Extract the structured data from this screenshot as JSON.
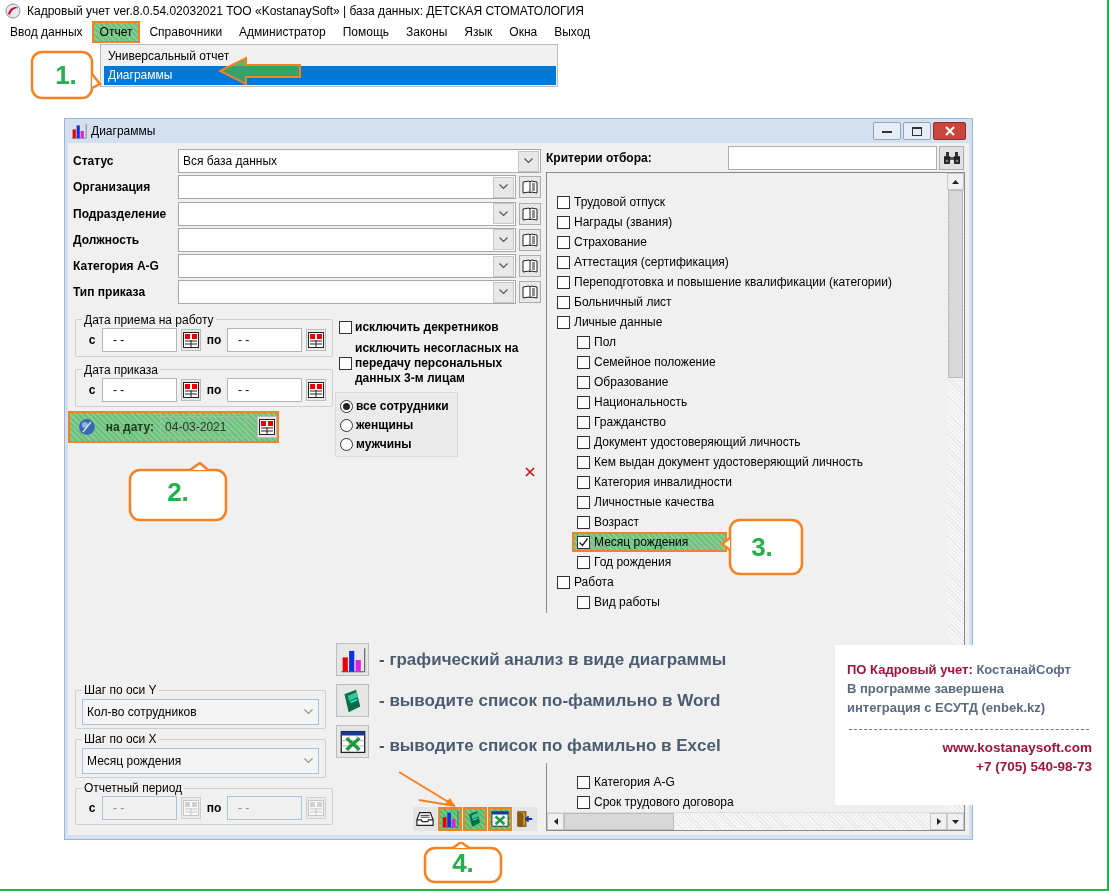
{
  "window": {
    "title": "Кадровый учет ver.8.0.54.02032021 ТОО «KostanaySoft» | база данных: ДЕТСКАЯ СТОМАТОЛОГИЯ"
  },
  "menu": [
    {
      "label": "Ввод данных",
      "selected": false
    },
    {
      "label": "Отчет",
      "selected": true
    },
    {
      "label": "Справочники",
      "selected": false
    },
    {
      "label": "Администратор",
      "selected": false
    },
    {
      "label": "Помощь",
      "selected": false
    },
    {
      "label": "Законы",
      "selected": false
    },
    {
      "label": "Язык",
      "selected": false
    },
    {
      "label": "Окна",
      "selected": false
    },
    {
      "label": "Выход",
      "selected": false
    }
  ],
  "dropdown": [
    {
      "label": "Универсальный отчет",
      "selected": false
    },
    {
      "label": "Диаграммы",
      "selected": true
    }
  ],
  "dialog": {
    "title": "Диаграммы",
    "fields": [
      {
        "label": "Статус",
        "value": "Вся база данных",
        "lookup": false
      },
      {
        "label": "Организация",
        "lookup": true
      },
      {
        "label": "Подразделение",
        "lookup": true
      },
      {
        "label": "Должность",
        "lookup": true
      },
      {
        "label": "Категория A-G",
        "lookup": true
      },
      {
        "label": "Тип приказа",
        "lookup": true
      }
    ],
    "hire_date": {
      "legend": "Дата приема на работу",
      "from_label": "с",
      "from": "- -",
      "to_label": "по",
      "to": "- -",
      "disabled": false
    },
    "order_date": {
      "legend": "Дата приказа",
      "from_label": "с",
      "from": "- -",
      "to_label": "по",
      "to": "- -",
      "disabled": false
    },
    "as_of": {
      "label": "на дату:",
      "value": "04-03-2021",
      "highlighted": true
    },
    "options": [
      {
        "label": "исключить декретников",
        "checked": false
      },
      {
        "label": "исключить несогласных на передачу персональных данных 3-м лицам",
        "checked": false
      }
    ],
    "gender": [
      {
        "label": "все сотрудники",
        "selected": true
      },
      {
        "label": "женщины",
        "selected": false
      },
      {
        "label": "мужчины",
        "selected": false
      }
    ],
    "y_axis": {
      "legend": "Шаг по оси Y",
      "value": "Кол-во сотрудников"
    },
    "x_axis": {
      "legend": "Шаг по оси X",
      "value": "Месяц рождения"
    },
    "period": {
      "legend": "Отчетный период",
      "from_label": "с",
      "from": "- -",
      "to_label": "по",
      "to": "- -",
      "disabled": true
    },
    "toolbar": [
      {
        "kind": "tray",
        "highlighted": false
      },
      {
        "kind": "chart",
        "highlighted": true
      },
      {
        "kind": "word",
        "highlighted": true
      },
      {
        "kind": "excel",
        "highlighted": true
      },
      {
        "kind": "exit",
        "highlighted": false
      }
    ],
    "criteria": {
      "label": "Критерии отбора:",
      "items": [
        {
          "label": "Трудовой отпуск",
          "checked": false,
          "highlighted": false
        },
        {
          "label": "Награды (звания)",
          "checked": false,
          "highlighted": false
        },
        {
          "label": "Страхование",
          "checked": false,
          "highlighted": false
        },
        {
          "label": "Аттестация (сертификация)",
          "checked": false,
          "highlighted": false
        },
        {
          "label": "Переподготовка и повышение квалификации (категории)",
          "checked": false,
          "highlighted": false
        },
        {
          "label": "Больничный лист",
          "checked": false,
          "highlighted": false
        },
        {
          "label": "Личные данные",
          "checked": false,
          "highlighted": false,
          "children": [
            {
              "label": "Пол",
              "checked": false,
              "highlighted": false
            },
            {
              "label": "Семейное положение",
              "checked": false,
              "highlighted": false
            },
            {
              "label": "Образование",
              "checked": false,
              "highlighted": false
            },
            {
              "label": "Национальность",
              "checked": false,
              "highlighted": false
            },
            {
              "label": "Гражданство",
              "checked": false,
              "highlighted": false
            },
            {
              "label": "Документ удостоверяющий личность",
              "checked": false,
              "highlighted": false
            },
            {
              "label": "Кем выдан документ удостоверяющий личность",
              "checked": false,
              "highlighted": false
            },
            {
              "label": "Категория инвалидности",
              "checked": false,
              "highlighted": false
            },
            {
              "label": "Личностные качества",
              "checked": false,
              "highlighted": false
            },
            {
              "label": "Возраст",
              "checked": false,
              "highlighted": false
            },
            {
              "label": "Месяц рождения",
              "checked": true,
              "highlighted": true
            },
            {
              "label": "Год рождения",
              "checked": false,
              "highlighted": false
            }
          ]
        },
        {
          "label": "Работа",
          "checked": false,
          "highlighted": false,
          "children": [
            {
              "label": "Вид работы",
              "checked": false,
              "highlighted": false
            }
          ]
        }
      ],
      "lower_items": [
        {
          "label": "Категория A-G",
          "checked": false,
          "highlighted": false
        },
        {
          "label": "Срок трудового договора",
          "checked": false,
          "highlighted": false
        }
      ]
    },
    "legend": [
      {
        "kind": "chart",
        "text": "- графический анализ в виде диаграммы"
      },
      {
        "kind": "word",
        "text": "- выводите список по-фамильно в Word"
      },
      {
        "kind": "excel",
        "text": "- выводите список по фамильно в Excel"
      }
    ]
  },
  "callouts": [
    {
      "text": "1."
    },
    {
      "text": "2."
    },
    {
      "text": "3."
    },
    {
      "text": "4."
    }
  ],
  "info_box": {
    "title": "ПО Кадровый учет:",
    "company": "КостанайСофт",
    "lines": [
      "В программе завершена",
      "интеграция с ЕСУТД (enbek.kz)"
    ],
    "website": "www.kostanaysoft.com",
    "phone": "+7 (705) 540-98-73"
  }
}
